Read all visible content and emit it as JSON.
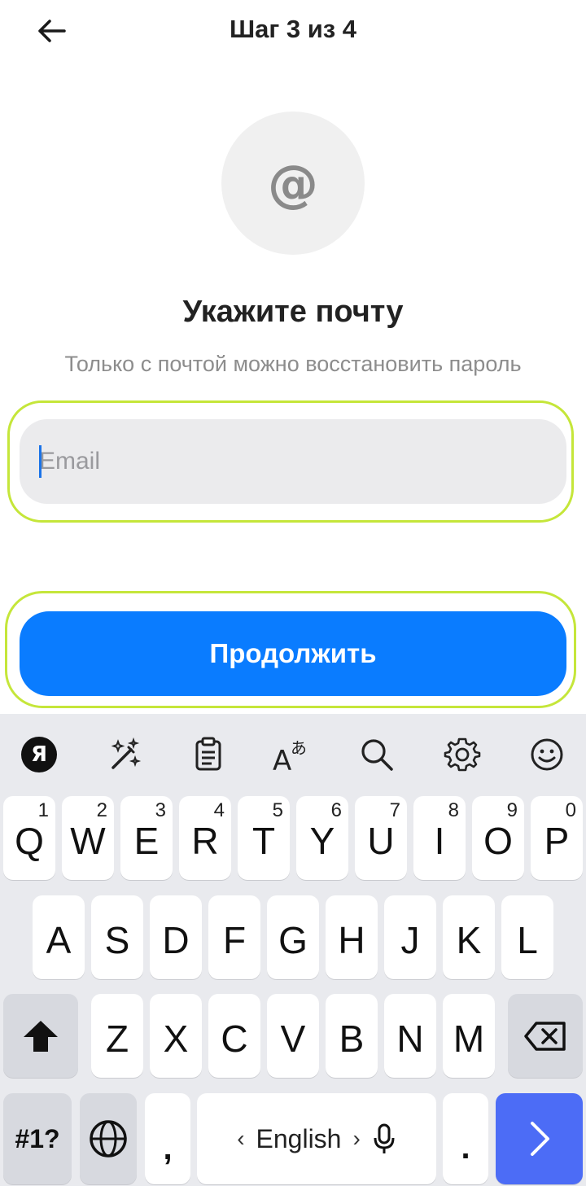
{
  "header": {
    "title": "Шаг 3 из 4",
    "back_icon": "arrow-left-icon"
  },
  "hero": {
    "icon_glyph": "@",
    "icon": "at-sign-icon",
    "heading": "Укажите почту",
    "subtitle": "Только с почтой можно восстановить пароль"
  },
  "form": {
    "email_placeholder": "Email",
    "email_value": "",
    "submit_label": "Продолжить"
  },
  "colors": {
    "accent": "#0a7cff",
    "highlight": "#c5e63a",
    "enter_key": "#4c6cf6"
  },
  "keyboard": {
    "toolbar": [
      "yandex-icon",
      "magic-wand-icon",
      "clipboard-icon",
      "translate-icon",
      "search-icon",
      "settings-icon",
      "emoji-icon"
    ],
    "toolbar_logo": "Я",
    "row1": [
      {
        "key": "Q",
        "num": "1"
      },
      {
        "key": "W",
        "num": "2"
      },
      {
        "key": "E",
        "num": "3"
      },
      {
        "key": "R",
        "num": "4"
      },
      {
        "key": "T",
        "num": "5"
      },
      {
        "key": "Y",
        "num": "6"
      },
      {
        "key": "U",
        "num": "7"
      },
      {
        "key": "I",
        "num": "8"
      },
      {
        "key": "O",
        "num": "9"
      },
      {
        "key": "P",
        "num": "0"
      }
    ],
    "row2": [
      "A",
      "S",
      "D",
      "F",
      "G",
      "H",
      "J",
      "K",
      "L"
    ],
    "row3": [
      "Z",
      "X",
      "C",
      "V",
      "B",
      "N",
      "M"
    ],
    "symbols_label": "#1?",
    "comma": ",",
    "period": ".",
    "space_label": "English",
    "space_left": "‹",
    "space_right": "›"
  }
}
